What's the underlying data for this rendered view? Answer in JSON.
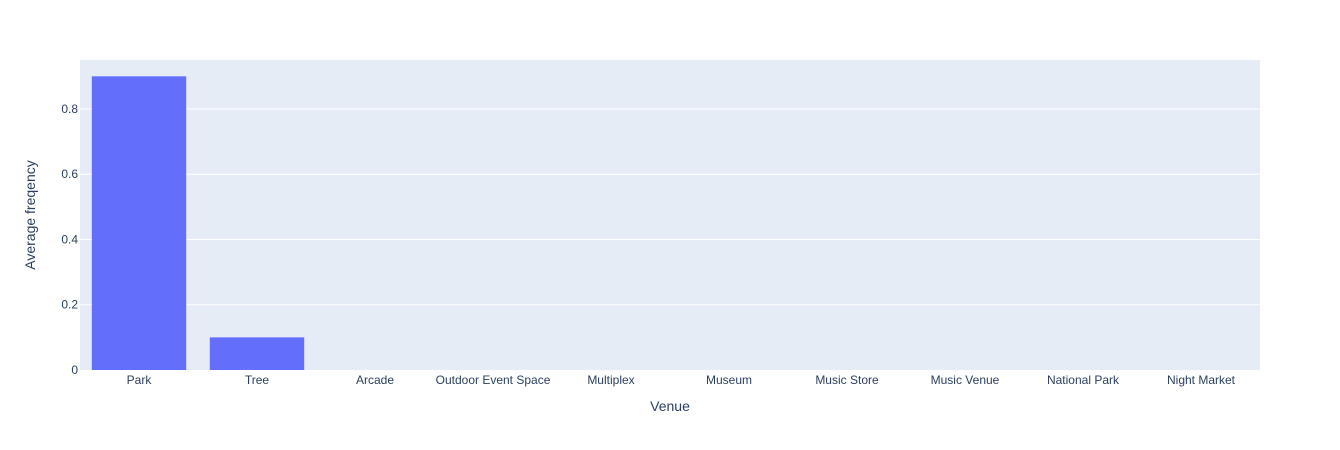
{
  "chart_data": {
    "type": "bar",
    "title": "",
    "xlabel": "Venue",
    "ylabel": "Average freqency",
    "categories": [
      "Park",
      "Tree",
      "Arcade",
      "Outdoor Event Space",
      "Multiplex",
      "Museum",
      "Music Store",
      "Music Venue",
      "National Park",
      "Night Market"
    ],
    "values": [
      0.9,
      0.1,
      0,
      0,
      0,
      0,
      0,
      0,
      0,
      0
    ],
    "ylim": [
      0,
      0.95
    ],
    "yticks": [
      0,
      0.2,
      0.4,
      0.6,
      0.8
    ],
    "ytick_labels": [
      "0",
      "0.2",
      "0.4",
      "0.6",
      "0.8"
    ],
    "grid": true,
    "legend": "none",
    "colors": {
      "bar": "#636efa",
      "plot_bg": "#e5ecf6",
      "grid": "#ffffff",
      "text": "#2a3f5f"
    }
  }
}
